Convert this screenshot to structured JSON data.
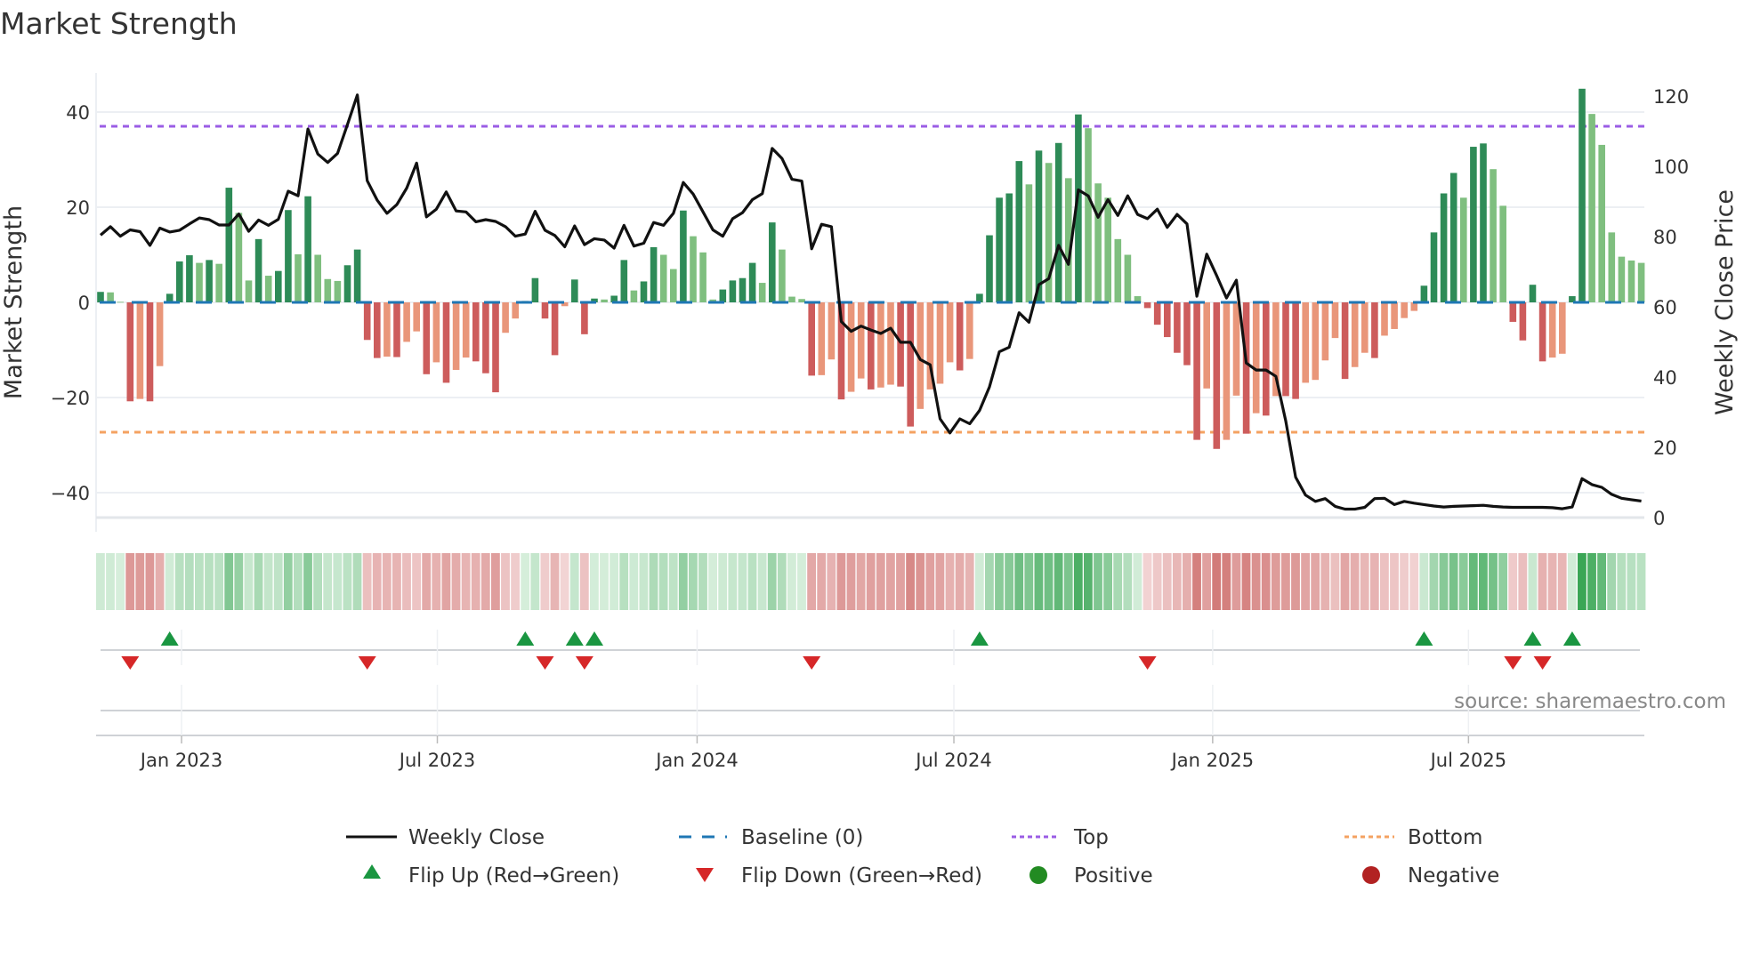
{
  "title": "Market Strength",
  "source": "source: sharemaestro.com",
  "chart_data": {
    "type": "bar+line",
    "title": "Market Strength",
    "ylabel_left": "Market Strength",
    "ylabel_right": "Weekly Close Price",
    "ylim_left": [
      -45.2,
      48.2
    ],
    "ylim_right": [
      0,
      126.6
    ],
    "left_ticks": [
      "40",
      "20",
      "0",
      "−20",
      "−40"
    ],
    "left_tick_values": [
      40,
      20,
      0,
      -20,
      -40
    ],
    "right_ticks": [
      "120",
      "100",
      "80",
      "60",
      "40",
      "20",
      "0"
    ],
    "right_tick_values": [
      120,
      100,
      80,
      60,
      40,
      20,
      0
    ],
    "x_ticks": [
      {
        "label": "Jan 2023",
        "week": 8.2
      },
      {
        "label": "Jul 2023",
        "week": 34.1
      },
      {
        "label": "Jan 2024",
        "week": 60.4
      },
      {
        "label": "Jul 2024",
        "week": 86.4
      },
      {
        "label": "Jan 2025",
        "week": 112.6
      },
      {
        "label": "Jul 2025",
        "week": 138.5
      }
    ],
    "top_level": 37,
    "bottom_level": -27.3,
    "baseline": 0,
    "strength": [
      2.2,
      2.1,
      0.1,
      -20.8,
      -20.3,
      -20.8,
      -13.4,
      1.8,
      8.6,
      9.9,
      8.3,
      8.9,
      8.1,
      24.1,
      18.8,
      4.6,
      13.3,
      5.6,
      6.6,
      19.4,
      10.1,
      22.3,
      10.0,
      4.9,
      4.5,
      7.8,
      11.1,
      -7.9,
      -11.7,
      -11.4,
      -11.5,
      -8.3,
      -6.1,
      -15.1,
      -12.6,
      -16.9,
      -14.2,
      -11.6,
      -12.4,
      -14.9,
      -18.9,
      -6.4,
      -3.4,
      0.3,
      5.1,
      -3.4,
      -11.1,
      -0.8,
      4.8,
      -6.7,
      0.8,
      0.6,
      1.4,
      8.9,
      2.5,
      4.4,
      11.6,
      10.0,
      7.0,
      19.3,
      13.9,
      10.5,
      0.6,
      2.7,
      4.6,
      5.1,
      8.3,
      4.1,
      16.8,
      11.1,
      1.2,
      0.7,
      -15.4,
      -15.3,
      -12.0,
      -20.4,
      -18.8,
      -16.0,
      -18.3,
      -17.9,
      -17.3,
      -17.7,
      -26.1,
      -22.4,
      -18.3,
      -17.1,
      -12.6,
      -14.3,
      -11.9,
      1.8,
      14.1,
      22.0,
      22.9,
      29.7,
      24.8,
      31.9,
      29.3,
      33.5,
      26.1,
      39.5,
      36.6,
      25.0,
      22.0,
      13.3,
      10.0,
      1.3,
      -1.2,
      -4.7,
      -7.3,
      -10.6,
      -13.2,
      -28.9,
      -18.1,
      -30.8,
      -28.9,
      -19.6,
      -27.6,
      -23.3,
      -23.8,
      -19.7,
      -19.7,
      -20.3,
      -16.9,
      -16.3,
      -12.2,
      -7.5,
      -16.1,
      -13.6,
      -10.6,
      -11.7,
      -7.0,
      -5.6,
      -3.3,
      -1.8,
      3.5,
      14.7,
      22.9,
      27.2,
      22.0,
      32.7,
      33.4,
      28.0,
      20.3,
      -4.1,
      -8.0,
      3.7,
      -12.4,
      -11.6,
      -10.8,
      1.3,
      44.9,
      39.6,
      33.1,
      14.7,
      9.6,
      8.8,
      8.3
    ],
    "weekly_close": [
      80.4,
      82.8,
      80.1,
      81.9,
      81.4,
      77.5,
      82.4,
      81.3,
      81.8,
      83.6,
      85.3,
      84.8,
      83.3,
      83.3,
      86.4,
      81.5,
      84.7,
      83.2,
      84.9,
      92.9,
      91.6,
      110.6,
      103.5,
      101.1,
      103.7,
      111.9,
      120.3,
      95.9,
      90.4,
      86.6,
      89.1,
      93.8,
      100.9,
      85.6,
      87.8,
      92.7,
      87.3,
      87.0,
      84.2,
      84.8,
      84.3,
      82.8,
      80.1,
      80.7,
      87.2,
      81.8,
      80.3,
      77.1,
      83.0,
      77.7,
      79.4,
      79.0,
      76.7,
      83.2,
      77.3,
      78.1,
      84.0,
      83.2,
      86.6,
      95.4,
      92.1,
      87.0,
      81.9,
      80.1,
      85.1,
      86.8,
      90.5,
      92.2,
      105.1,
      102.2,
      96.3,
      95.8,
      76.5,
      83.5,
      82.8,
      55.8,
      53.0,
      54.5,
      53.4,
      52.4,
      53.9,
      49.9,
      49.9,
      45.0,
      43.5,
      28.1,
      24.1,
      28.1,
      26.7,
      30.5,
      37.2,
      47.2,
      48.5,
      58.3,
      55.6,
      66.3,
      68.0,
      77.5,
      72.1,
      93.3,
      91.6,
      85.5,
      90.5,
      86.0,
      91.6,
      86.3,
      85.1,
      87.8,
      82.6,
      86.3,
      83.6,
      63.0,
      75.0,
      68.9,
      62.5,
      67.6,
      44.0,
      42.0,
      42.0,
      40.2,
      27.5,
      11.5,
      6.4,
      4.6,
      5.4,
      3.2,
      2.4,
      2.4,
      2.9,
      5.4,
      5.5,
      3.7,
      4.6,
      4.1,
      3.7,
      3.3,
      3.0,
      3.2,
      3.3,
      3.4,
      3.5,
      3.2,
      3.0,
      2.9,
      2.9,
      2.9,
      2.9,
      2.8,
      2.5,
      3.0,
      11.1,
      9.4,
      8.6,
      6.6,
      5.5,
      5.1,
      4.7
    ],
    "legend": {
      "weekly_close": "Weekly Close",
      "baseline": "Baseline (0)",
      "top": "Top",
      "bottom": "Bottom",
      "flip_up": "Flip Up (Red→Green)",
      "flip_down": "Flip Down (Green→Red)",
      "positive": "Positive",
      "negative": "Negative"
    },
    "legend_placement": "bottom",
    "colors": {
      "rising_green": "#2e8b57",
      "falling_green": "#7fbf7f",
      "falling_red": "#cd5c5c",
      "rising_red": "#e9967a",
      "line": "#111111",
      "baseline": "#1f77b4",
      "top": "#9b5de5",
      "bottom": "#f4a261",
      "flip_up": "#1a9641",
      "flip_down": "#d62728",
      "positive": "#228b22",
      "negative": "#b22222"
    }
  }
}
